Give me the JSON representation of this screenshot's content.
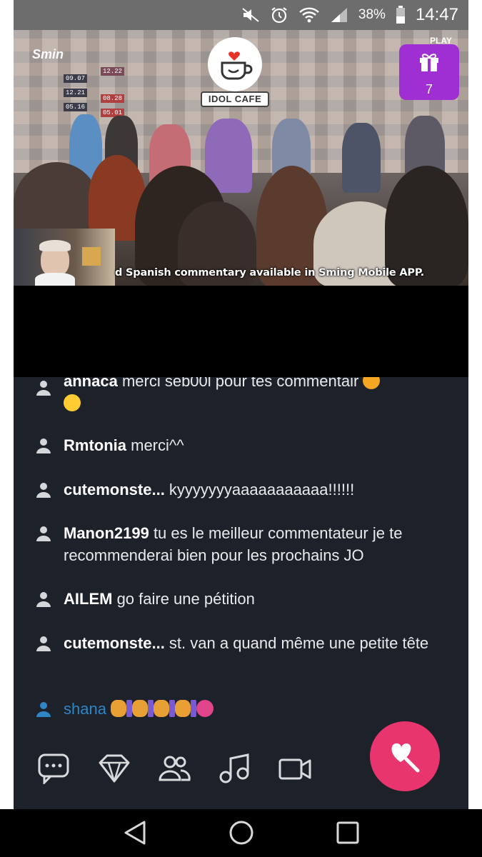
{
  "status_bar": {
    "battery_percent": "38%",
    "time": "14:47",
    "icons": [
      "mute-icon",
      "alarm-icon",
      "wifi-icon",
      "signal-icon",
      "battery-icon"
    ]
  },
  "video": {
    "channel_logo": "Smin",
    "cafe_logo_text": "IDOL CAFE",
    "gift_count": "7",
    "corner_tag": "PLAY",
    "subtitle": "d Spanish commentary available in Sming Mobile APP.",
    "date_tags": [
      "09.07",
      "12.21",
      "05.16",
      "12.22",
      "08.28",
      "05.01"
    ]
  },
  "chat": {
    "messages": [
      {
        "user": "annaca",
        "text": " merci seb00l pour tes commentair "
      },
      {
        "user": "Rmtonia",
        "text": " merci^^"
      },
      {
        "user": "cutemonste...",
        "text": " kyyyyyyyaaaaaaaaaaa!!!!!!"
      },
      {
        "user": "Manon2199",
        "text": " tu es le meilleur commentateur je te recommenderai bien pour les prochains JO"
      },
      {
        "user": "AILEM",
        "text": " go faire une pétition"
      },
      {
        "user": "cutemonste...",
        "text": " st. van a quand même une petite tête"
      },
      {
        "user": "shana",
        "text": ""
      }
    ]
  },
  "toolbar": {
    "icons": [
      "chat-icon",
      "diamond-icon",
      "users-icon",
      "music-icon",
      "video-camera-icon"
    ],
    "fab_icon": "heart-lollipop-icon"
  },
  "nav": {
    "icons": [
      "back-icon",
      "home-icon",
      "recents-icon"
    ]
  },
  "colors": {
    "chat_bg": "#1d2129",
    "fab": "#e8356e",
    "gift": "#9f2fd2",
    "highlight_user": "#2f86c6"
  }
}
